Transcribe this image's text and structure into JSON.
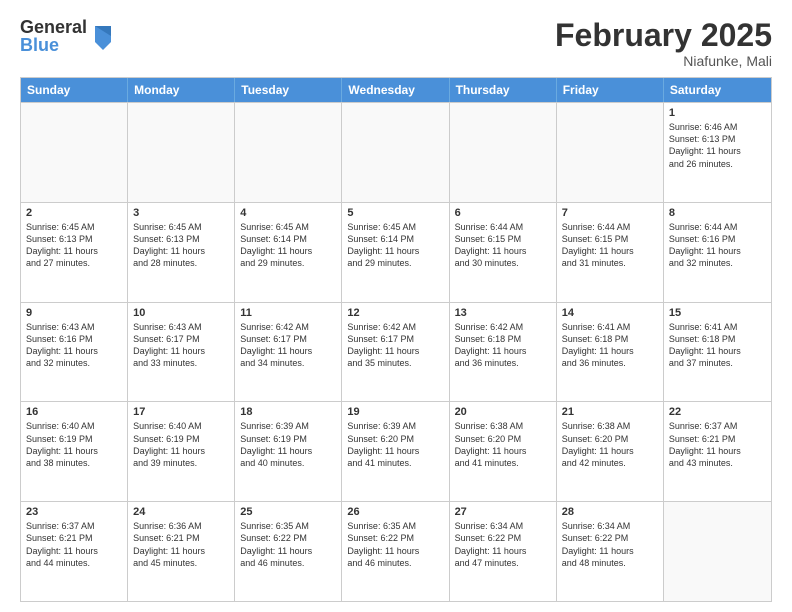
{
  "logo": {
    "general": "General",
    "blue": "Blue"
  },
  "title": "February 2025",
  "location": "Niafunke, Mali",
  "days": [
    "Sunday",
    "Monday",
    "Tuesday",
    "Wednesday",
    "Thursday",
    "Friday",
    "Saturday"
  ],
  "rows": [
    [
      {
        "day": "",
        "info": ""
      },
      {
        "day": "",
        "info": ""
      },
      {
        "day": "",
        "info": ""
      },
      {
        "day": "",
        "info": ""
      },
      {
        "day": "",
        "info": ""
      },
      {
        "day": "",
        "info": ""
      },
      {
        "day": "1",
        "info": "Sunrise: 6:46 AM\nSunset: 6:13 PM\nDaylight: 11 hours\nand 26 minutes."
      }
    ],
    [
      {
        "day": "2",
        "info": "Sunrise: 6:45 AM\nSunset: 6:13 PM\nDaylight: 11 hours\nand 27 minutes."
      },
      {
        "day": "3",
        "info": "Sunrise: 6:45 AM\nSunset: 6:13 PM\nDaylight: 11 hours\nand 28 minutes."
      },
      {
        "day": "4",
        "info": "Sunrise: 6:45 AM\nSunset: 6:14 PM\nDaylight: 11 hours\nand 29 minutes."
      },
      {
        "day": "5",
        "info": "Sunrise: 6:45 AM\nSunset: 6:14 PM\nDaylight: 11 hours\nand 29 minutes."
      },
      {
        "day": "6",
        "info": "Sunrise: 6:44 AM\nSunset: 6:15 PM\nDaylight: 11 hours\nand 30 minutes."
      },
      {
        "day": "7",
        "info": "Sunrise: 6:44 AM\nSunset: 6:15 PM\nDaylight: 11 hours\nand 31 minutes."
      },
      {
        "day": "8",
        "info": "Sunrise: 6:44 AM\nSunset: 6:16 PM\nDaylight: 11 hours\nand 32 minutes."
      }
    ],
    [
      {
        "day": "9",
        "info": "Sunrise: 6:43 AM\nSunset: 6:16 PM\nDaylight: 11 hours\nand 32 minutes."
      },
      {
        "day": "10",
        "info": "Sunrise: 6:43 AM\nSunset: 6:17 PM\nDaylight: 11 hours\nand 33 minutes."
      },
      {
        "day": "11",
        "info": "Sunrise: 6:42 AM\nSunset: 6:17 PM\nDaylight: 11 hours\nand 34 minutes."
      },
      {
        "day": "12",
        "info": "Sunrise: 6:42 AM\nSunset: 6:17 PM\nDaylight: 11 hours\nand 35 minutes."
      },
      {
        "day": "13",
        "info": "Sunrise: 6:42 AM\nSunset: 6:18 PM\nDaylight: 11 hours\nand 36 minutes."
      },
      {
        "day": "14",
        "info": "Sunrise: 6:41 AM\nSunset: 6:18 PM\nDaylight: 11 hours\nand 36 minutes."
      },
      {
        "day": "15",
        "info": "Sunrise: 6:41 AM\nSunset: 6:18 PM\nDaylight: 11 hours\nand 37 minutes."
      }
    ],
    [
      {
        "day": "16",
        "info": "Sunrise: 6:40 AM\nSunset: 6:19 PM\nDaylight: 11 hours\nand 38 minutes."
      },
      {
        "day": "17",
        "info": "Sunrise: 6:40 AM\nSunset: 6:19 PM\nDaylight: 11 hours\nand 39 minutes."
      },
      {
        "day": "18",
        "info": "Sunrise: 6:39 AM\nSunset: 6:19 PM\nDaylight: 11 hours\nand 40 minutes."
      },
      {
        "day": "19",
        "info": "Sunrise: 6:39 AM\nSunset: 6:20 PM\nDaylight: 11 hours\nand 41 minutes."
      },
      {
        "day": "20",
        "info": "Sunrise: 6:38 AM\nSunset: 6:20 PM\nDaylight: 11 hours\nand 41 minutes."
      },
      {
        "day": "21",
        "info": "Sunrise: 6:38 AM\nSunset: 6:20 PM\nDaylight: 11 hours\nand 42 minutes."
      },
      {
        "day": "22",
        "info": "Sunrise: 6:37 AM\nSunset: 6:21 PM\nDaylight: 11 hours\nand 43 minutes."
      }
    ],
    [
      {
        "day": "23",
        "info": "Sunrise: 6:37 AM\nSunset: 6:21 PM\nDaylight: 11 hours\nand 44 minutes."
      },
      {
        "day": "24",
        "info": "Sunrise: 6:36 AM\nSunset: 6:21 PM\nDaylight: 11 hours\nand 45 minutes."
      },
      {
        "day": "25",
        "info": "Sunrise: 6:35 AM\nSunset: 6:22 PM\nDaylight: 11 hours\nand 46 minutes."
      },
      {
        "day": "26",
        "info": "Sunrise: 6:35 AM\nSunset: 6:22 PM\nDaylight: 11 hours\nand 46 minutes."
      },
      {
        "day": "27",
        "info": "Sunrise: 6:34 AM\nSunset: 6:22 PM\nDaylight: 11 hours\nand 47 minutes."
      },
      {
        "day": "28",
        "info": "Sunrise: 6:34 AM\nSunset: 6:22 PM\nDaylight: 11 hours\nand 48 minutes."
      },
      {
        "day": "",
        "info": ""
      }
    ]
  ]
}
